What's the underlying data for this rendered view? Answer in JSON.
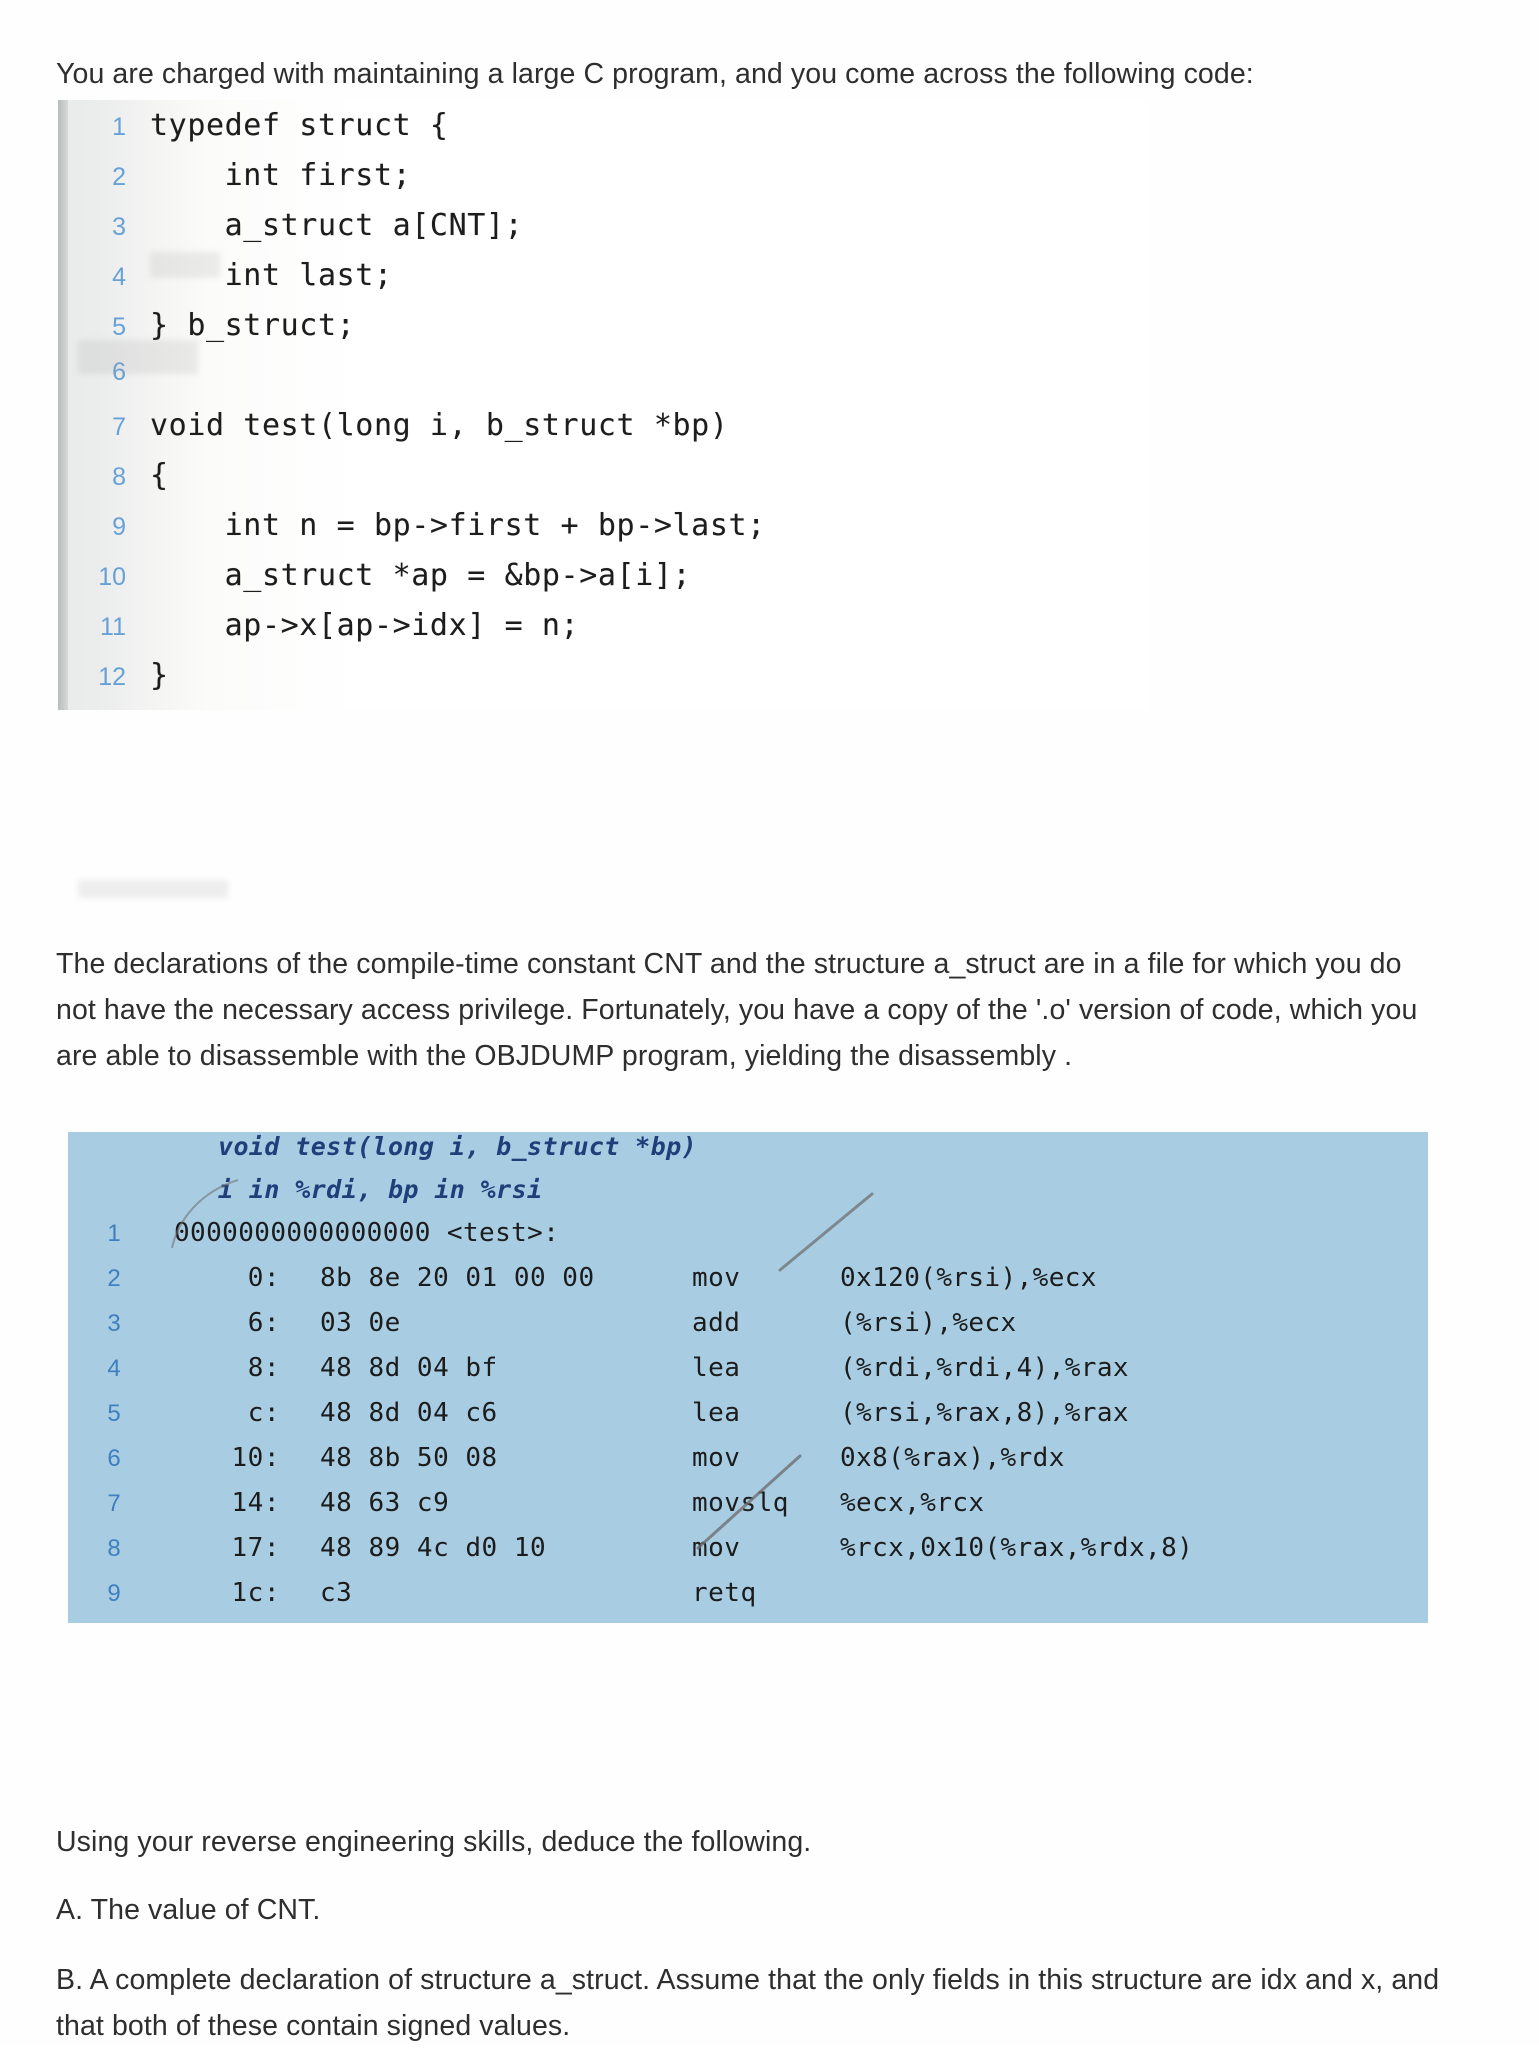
{
  "document": {
    "intro_paragraph": "You are charged with maintaining a large C program, and you come across the following code:",
    "middle_paragraph": "The declarations of the compile-time constant CNT and the structure a_struct are in a file for which you do not have the necessary access privilege. Fortunately, you have a copy of the '.o' version of code, which you are able to disassemble with the OBJDUMP program, yielding the disassembly .",
    "closing_line": "Using your reverse engineering skills, deduce the following.",
    "question_a": "A. The value of CNT.",
    "question_b": "B. A complete declaration of structure a_struct. Assume that the only fields in this structure are idx and x, and that both of these contain signed values."
  },
  "code_listing": {
    "background_color": "#f2f2f1",
    "line_number_color": "#5b9bd5",
    "lines": [
      {
        "number": "1",
        "text": "typedef struct {"
      },
      {
        "number": "2",
        "text": "    int first;"
      },
      {
        "number": "3",
        "text": "    a_struct a[CNT];"
      },
      {
        "number": "4",
        "text": "    int last;"
      },
      {
        "number": "5",
        "text": "} b_struct;"
      },
      {
        "number": "6",
        "text": ""
      },
      {
        "number": "7",
        "text": "void test(long i, b_struct *bp)"
      },
      {
        "number": "8",
        "text": "{"
      },
      {
        "number": "9",
        "text": "    int n = bp->first + bp->last;"
      },
      {
        "number": "10",
        "text": "    a_struct *ap = &bp->a[i];"
      },
      {
        "number": "11",
        "text": "    ap->x[ap->idx] = n;"
      },
      {
        "number": "12",
        "text": "}"
      }
    ]
  },
  "disassembly": {
    "highlight_color": "#a8cde3",
    "header_color": "#1e3f7a",
    "line_number_color": "#3f7fbf",
    "header_lines": [
      "void test(long i, b_struct *bp)",
      "i in %rdi, bp in %rsi"
    ],
    "symbol_line": {
      "number": "1",
      "text": "0000000000000000 <test>:"
    },
    "instructions": [
      {
        "number": "2",
        "address": "0:",
        "bytes": "8b 8e 20 01 00 00",
        "mnemonic": "mov",
        "operands": "0x120(%rsi),%ecx"
      },
      {
        "number": "3",
        "address": "6:",
        "bytes": "03 0e",
        "mnemonic": "add",
        "operands": "(%rsi),%ecx"
      },
      {
        "number": "4",
        "address": "8:",
        "bytes": "48 8d 04 bf",
        "mnemonic": "lea",
        "operands": "(%rdi,%rdi,4),%rax"
      },
      {
        "number": "5",
        "address": "c:",
        "bytes": "48 8d 04 c6",
        "mnemonic": "lea",
        "operands": "(%rsi,%rax,8),%rax"
      },
      {
        "number": "6",
        "address": "10:",
        "bytes": "48 8b 50 08",
        "mnemonic": "mov",
        "operands": "0x8(%rax),%rdx"
      },
      {
        "number": "7",
        "address": "14:",
        "bytes": "48 63 c9",
        "mnemonic": "movslq",
        "operands": "%ecx,%rcx"
      },
      {
        "number": "8",
        "address": "17:",
        "bytes": "48 89 4c d0 10",
        "mnemonic": "mov",
        "operands": "%rcx,0x10(%rax,%rdx,8)"
      },
      {
        "number": "9",
        "address": "1c:",
        "bytes": "c3",
        "mnemonic": "retq",
        "operands": ""
      }
    ],
    "annotations": [
      {
        "name": "pencil-slash-upper",
        "description": "handwritten diagonal pencil stroke"
      },
      {
        "name": "pencil-slash-lower",
        "description": "handwritten diagonal pencil stroke through 10"
      }
    ]
  }
}
